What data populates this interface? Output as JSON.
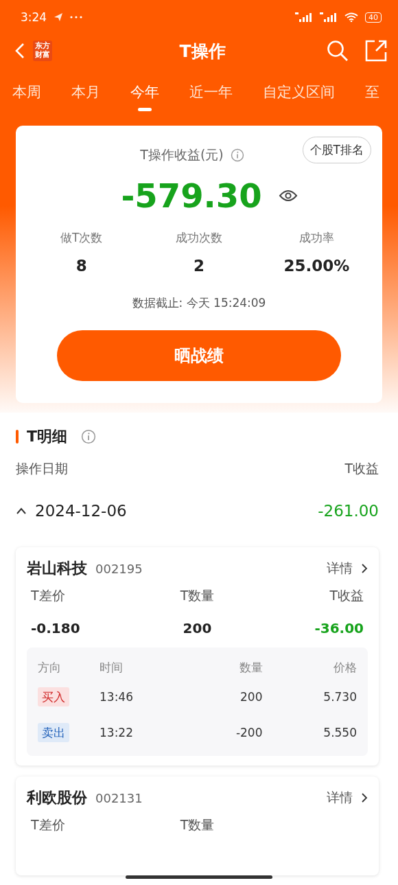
{
  "status_bar": {
    "time": "3:24",
    "battery": "40"
  },
  "header": {
    "logo": "东方财富",
    "title": "T操作"
  },
  "tabs": [
    {
      "label": "本周",
      "selected": false
    },
    {
      "label": "本月",
      "selected": false
    },
    {
      "label": "今年",
      "selected": true
    },
    {
      "label": "近一年",
      "selected": false
    },
    {
      "label": "自定义区间",
      "selected": false
    },
    {
      "label": "至",
      "selected": false
    }
  ],
  "summary": {
    "label": "T操作收益(元)",
    "rank_button": "个股T排名",
    "total": "-579.30",
    "stats": [
      {
        "label": "做T次数",
        "value": "8"
      },
      {
        "label": "成功次数",
        "value": "2"
      },
      {
        "label": "成功率",
        "value": "25.00%"
      }
    ],
    "as_of": "数据截止: 今天 15:24:09",
    "share_button": "晒战绩"
  },
  "detail": {
    "title": "T明细",
    "columns": [
      "操作日期",
      "T收益"
    ],
    "groups": [
      {
        "date": "2024-12-06",
        "pnl": "-261.00",
        "expanded": true,
        "stocks": [
          {
            "name": "岩山科技",
            "code": "002195",
            "link": "详情",
            "metrics": [
              {
                "label": "T差价",
                "value": "-0.180",
                "kind": "plain"
              },
              {
                "label": "T数量",
                "value": "200",
                "kind": "plain"
              },
              {
                "label": "T收益",
                "value": "-36.00",
                "kind": "loss"
              }
            ],
            "trade_columns": [
              "方向",
              "时间",
              "数量",
              "价格"
            ],
            "trades": [
              {
                "side": "买入",
                "kind": "buy",
                "time": "13:46",
                "qty": "200",
                "price": "5.730"
              },
              {
                "side": "卖出",
                "kind": "sell",
                "time": "13:22",
                "qty": "-200",
                "price": "5.550"
              }
            ]
          },
          {
            "name": "利欧股份",
            "code": "002131",
            "link": "详情",
            "metrics": [
              {
                "label": "T差价"
              },
              {
                "label": "T数量"
              }
            ]
          }
        ]
      }
    ]
  }
}
